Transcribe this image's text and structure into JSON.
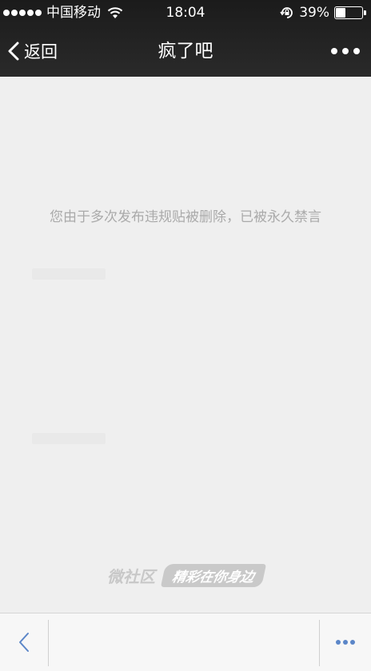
{
  "status_bar": {
    "carrier": "中国移动",
    "time": "18:04",
    "battery_percent": "39%",
    "battery_level": 0.39,
    "icons": [
      "signal-dots",
      "wifi-icon",
      "rotation-lock-icon",
      "battery-icon"
    ]
  },
  "navbar": {
    "back_label": "返回",
    "title": "疯了吧",
    "more_icon": "more-dots-icon"
  },
  "content": {
    "ban_message": "您由于多次发布违规贴被删除，已被永久禁言"
  },
  "branding": {
    "name": "微社区",
    "slogan": "精彩在你身边"
  },
  "toolbar": {
    "back_icon": "chevron-left-icon",
    "more_icon": "more-dots-icon",
    "accent_color": "#5b86c8"
  }
}
